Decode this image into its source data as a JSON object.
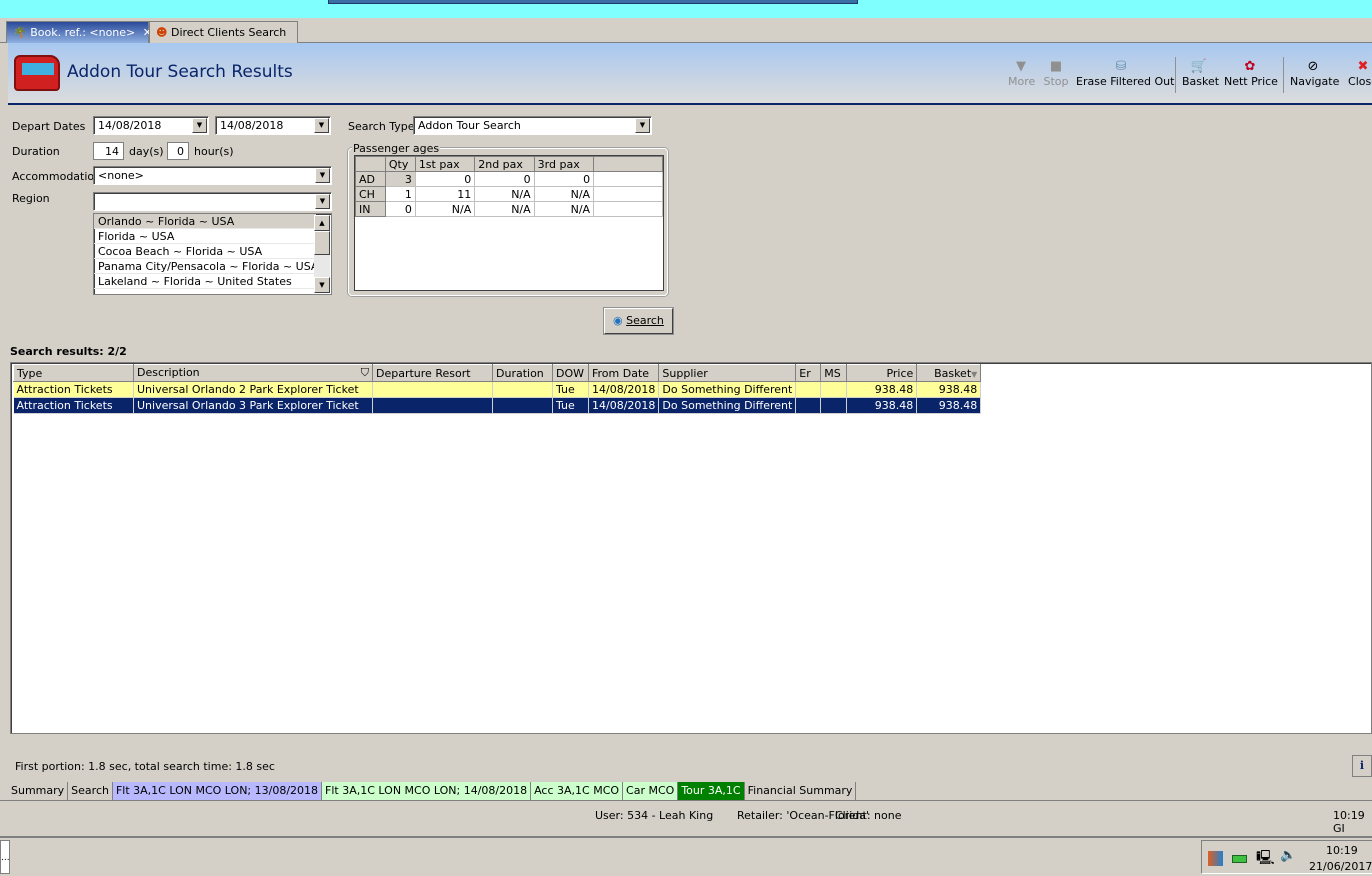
{
  "tabs": [
    {
      "label": "Book. ref.: <none>"
    },
    {
      "label": "Direct Clients Search"
    }
  ],
  "header": {
    "title": "Addon Tour Search Results"
  },
  "toolbar": {
    "more": "More",
    "stop": "Stop",
    "erase": "Erase Filtered Out",
    "basket": "Basket",
    "nett_price": "Nett Price",
    "navigate": "Navigate",
    "close": "Close"
  },
  "form": {
    "depart_label": "Depart Dates",
    "depart_from": "14/08/2018",
    "depart_to": "14/08/2018",
    "duration_label": "Duration",
    "duration_days": "14",
    "days_unit": "day(s)",
    "duration_hours": "0",
    "hours_unit": "hour(s)",
    "accommodation_label": "Accommodation",
    "accommodation_value": "<none>",
    "region_label": "Region",
    "region_value": "",
    "regions": [
      "Orlando ~ Florida ~ USA",
      "Florida ~ USA",
      "Cocoa Beach ~ Florida ~ USA",
      "Panama City/Pensacola ~  Florida  ~ USA",
      "Lakeland ~ Florida ~ United States"
    ],
    "search_type_label": "Search Type",
    "search_type_value": "Addon Tour Search",
    "pax_legend": "Passenger ages",
    "pax_headers": [
      "",
      "Qty",
      "1st pax",
      "2nd pax",
      "3rd pax"
    ],
    "pax_rows": [
      [
        "AD",
        "3",
        "0",
        "0",
        "0"
      ],
      [
        "CH",
        "1",
        "11",
        "N/A",
        "N/A"
      ],
      [
        "IN",
        "0",
        "N/A",
        "N/A",
        "N/A"
      ]
    ],
    "search_button": "Search"
  },
  "results": {
    "label": "Search results: 2/2",
    "columns": [
      "Type",
      "Description",
      "Departure Resort",
      "Duration",
      "DOW",
      "From Date",
      "Supplier",
      "Er",
      "MS",
      "Price",
      "Basket"
    ],
    "rows": [
      [
        "Attraction Tickets",
        "Universal Orlando 2 Park Explorer Ticket",
        "",
        "",
        "Tue",
        "14/08/2018",
        "Do Something Different",
        "",
        "",
        "938.48",
        "938.48"
      ],
      [
        "Attraction Tickets",
        "Universal Orlando 3 Park Explorer Ticket",
        "",
        "",
        "Tue",
        "14/08/2018",
        "Do Something Different",
        "",
        "",
        "938.48",
        "938.48"
      ]
    ],
    "timing": "First portion: 1.8 sec, total search time: 1.8 sec"
  },
  "bottom_tabs": [
    {
      "label": "Summary",
      "color": "#d4d0c8"
    },
    {
      "label": "Search",
      "color": "#d4d0c8"
    },
    {
      "label": "Flt 3A,1C LON MCO LON; 13/08/2018",
      "color": "#b8b8ff"
    },
    {
      "label": "Flt 3A,1C LON MCO LON; 14/08/2018",
      "color": "#ccffcc"
    },
    {
      "label": "Acc 3A,1C MCO",
      "color": "#ccffcc"
    },
    {
      "label": "Car MCO",
      "color": "#ccffcc"
    },
    {
      "label": "Tour 3A,1C",
      "color": "#008000"
    },
    {
      "label": "Financial Summary",
      "color": "#d4d0c8"
    }
  ],
  "status": {
    "user": "User: 534 - Leah King",
    "retailer": "Retailer: 'Ocean-Florida'",
    "client": "Client: none",
    "time": "10:19 GI"
  },
  "taskbar": {
    "time": "10:19",
    "date": "21/06/2017",
    "start": "..."
  }
}
